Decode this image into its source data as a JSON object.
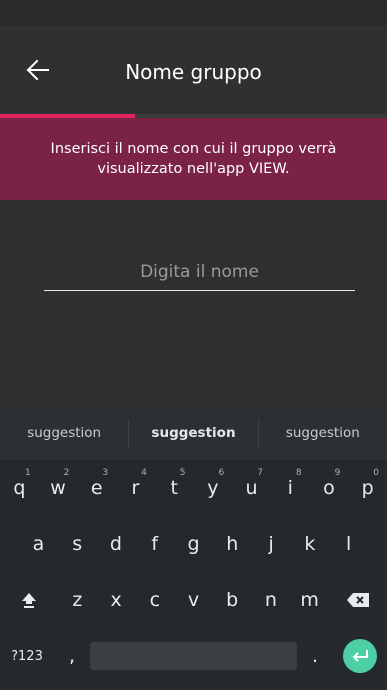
{
  "header": {
    "title": "Nome gruppo",
    "back_icon": "arrow-left-icon"
  },
  "progress": {
    "fraction": 0.35
  },
  "info_banner": {
    "text": "Inserisci il nome con cui il gruppo verrà visualizzato nell'app VIEW."
  },
  "name_field": {
    "placeholder": "Digita il nome",
    "value": ""
  },
  "keyboard": {
    "suggestions": [
      "suggestion",
      "suggestion",
      "suggestion"
    ],
    "row1": [
      {
        "label": "q",
        "hint": "1"
      },
      {
        "label": "w",
        "hint": "2"
      },
      {
        "label": "e",
        "hint": "3"
      },
      {
        "label": "r",
        "hint": "4"
      },
      {
        "label": "t",
        "hint": "5"
      },
      {
        "label": "y",
        "hint": "6"
      },
      {
        "label": "u",
        "hint": "7"
      },
      {
        "label": "i",
        "hint": "8"
      },
      {
        "label": "o",
        "hint": "9"
      },
      {
        "label": "p",
        "hint": "0"
      }
    ],
    "row2": [
      "a",
      "s",
      "d",
      "f",
      "g",
      "h",
      "j",
      "k",
      "l"
    ],
    "row3": [
      "z",
      "x",
      "c",
      "v",
      "b",
      "n",
      "m"
    ],
    "shift_icon": "shift-icon",
    "backspace_icon": "backspace-icon",
    "symbols_label": "?123",
    "comma_label": ",",
    "period_label": ".",
    "enter_icon": "enter-icon"
  },
  "colors": {
    "accent": "#e0245e",
    "banner": "#7b2345",
    "enter": "#4dd0a6"
  }
}
